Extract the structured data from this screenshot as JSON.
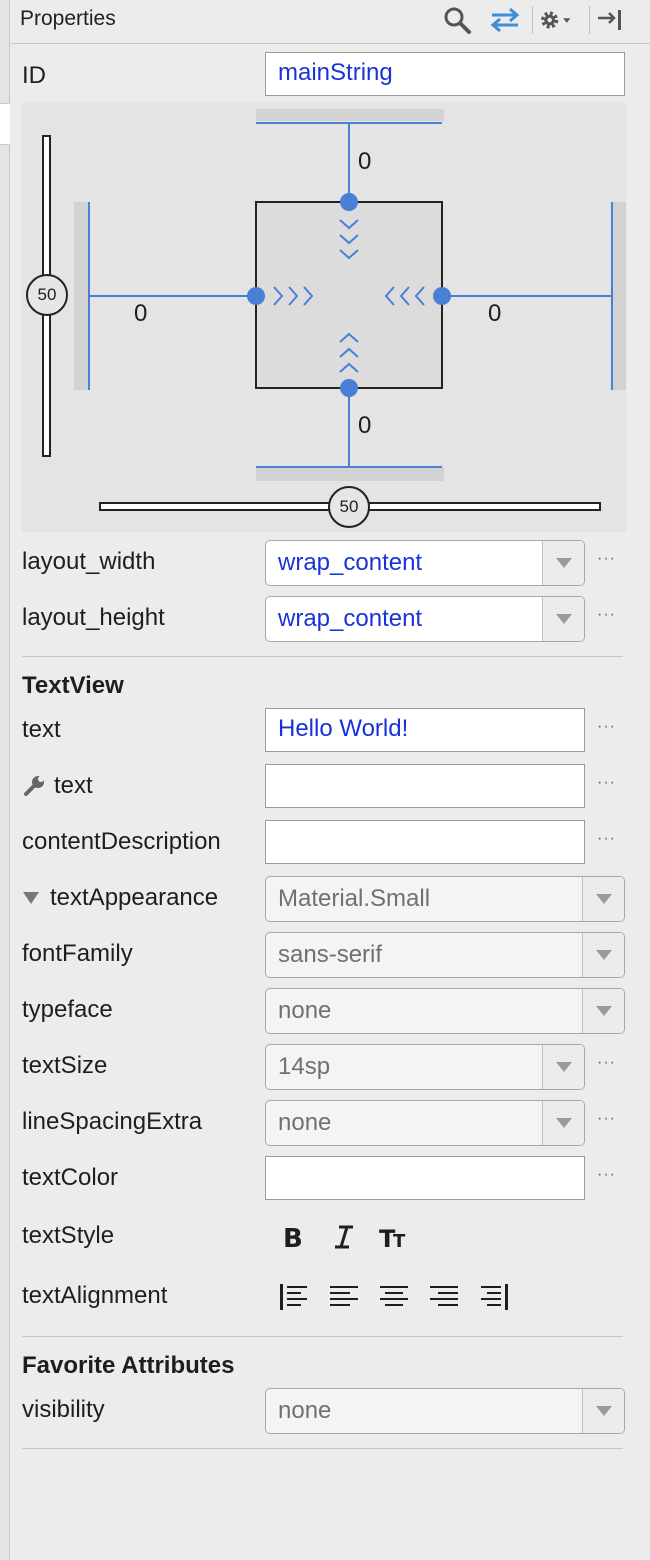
{
  "panel": {
    "title": "Properties"
  },
  "toolbar_icons": [
    "search-icon",
    "swap-arrows-icon",
    "gear-icon",
    "dropdown-caret-icon",
    "hide-panel-icon"
  ],
  "id_row": {
    "label": "ID",
    "value": "mainString"
  },
  "constraint_editor": {
    "margin_top": "0",
    "margin_bottom": "0",
    "margin_left": "0",
    "margin_right": "0",
    "vertical_bias": "50",
    "horizontal_bias": "50"
  },
  "layout": {
    "width_label": "layout_width",
    "width_value": "wrap_content",
    "height_label": "layout_height",
    "height_value": "wrap_content"
  },
  "textview": {
    "section_title": "TextView",
    "text_label": "text",
    "text_value": "Hello World!",
    "tools_text_label": "text",
    "tools_text_value": "",
    "content_description_label": "contentDescription",
    "content_description_value": "",
    "text_appearance_label": "textAppearance",
    "text_appearance_value": "Material.Small",
    "font_family_label": "fontFamily",
    "font_family_value": "sans-serif",
    "typeface_label": "typeface",
    "typeface_value": "none",
    "text_size_label": "textSize",
    "text_size_value": "14sp",
    "line_spacing_label": "lineSpacingExtra",
    "line_spacing_value": "none",
    "text_color_label": "textColor",
    "text_color_value": "",
    "text_style_label": "textStyle",
    "text_style_buttons": [
      "bold-icon",
      "italic-icon",
      "all-caps-icon"
    ],
    "text_alignment_label": "textAlignment",
    "text_alignment_buttons": [
      "align-view-start-icon",
      "align-left-icon",
      "align-center-icon",
      "align-right-icon",
      "align-view-end-icon"
    ]
  },
  "favorites": {
    "section_title": "Favorite Attributes",
    "visibility_label": "visibility",
    "visibility_value": "none"
  },
  "ellipsis": "···",
  "colors": {
    "value_blue": "#1a33d6",
    "constraint_blue": "#4a7fd6",
    "panel_bg": "#ececec"
  }
}
